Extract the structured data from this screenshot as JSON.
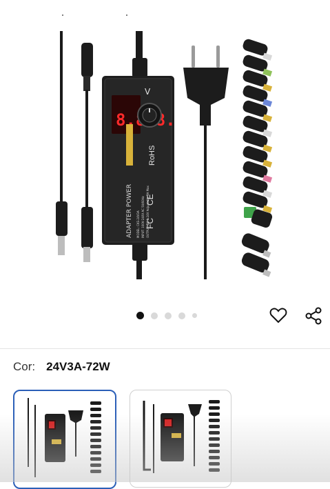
{
  "gallery": {
    "slide_count": 5,
    "active_index": 0,
    "product_label": "ADAPTER POWER",
    "display_digits": "8.8.8.",
    "display_unit": "V",
    "voltage_label": "VOLTAGE",
    "model_line": "MODEL: CKS-24V3A",
    "input_line": "INPUT: 100V-240V AC 50/60Hz",
    "output_line": "OUTPUT: DC 3-24V Adjustable 3A Max",
    "rohs": "RoHS",
    "ce": "CE",
    "fc": "FC"
  },
  "actions": {
    "favorite_icon": "heart-icon",
    "share_icon": "share-icon"
  },
  "variant": {
    "label": "Cor:",
    "value": "24V3A-72W"
  },
  "thumbnails": [
    {
      "selected": true
    },
    {
      "selected": false
    }
  ],
  "colors": {
    "selected_border": "#2b5fb8",
    "display_red": "#ff2a2a",
    "connector_gold": "#d8b23a"
  }
}
